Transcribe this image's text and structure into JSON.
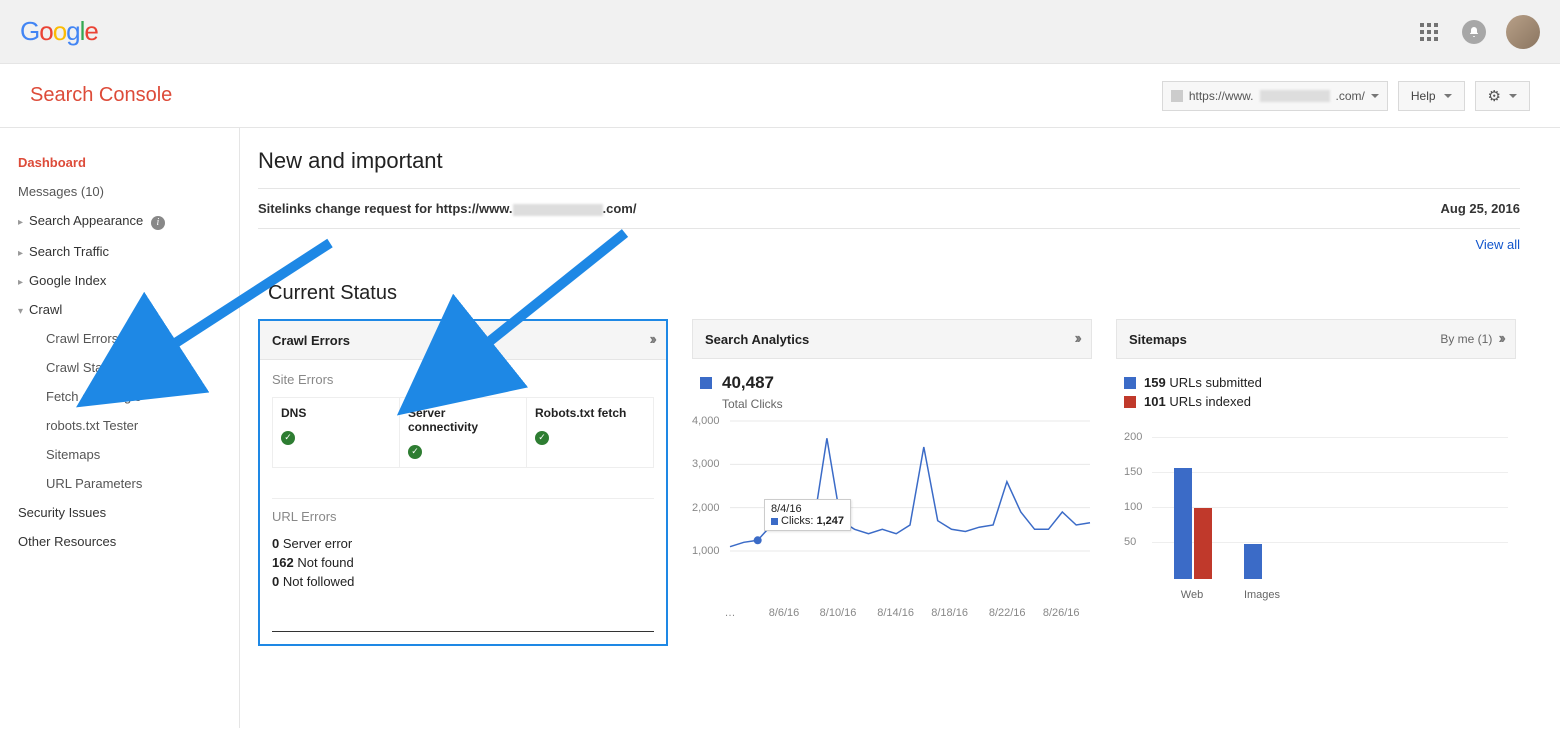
{
  "topbar": {
    "logo": "Google"
  },
  "header": {
    "app_title": "Search Console",
    "site_prefix": "https://www.",
    "site_suffix": ".com/",
    "help_label": "Help"
  },
  "sidebar": {
    "dashboard": "Dashboard",
    "messages": "Messages (10)",
    "search_appearance": "Search Appearance",
    "search_traffic": "Search Traffic",
    "google_index": "Google Index",
    "crawl": "Crawl",
    "crawl_errors": "Crawl Errors",
    "crawl_stats": "Crawl Stats",
    "fetch_as_google": "Fetch as Google",
    "robots_tester": "robots.txt Tester",
    "sitemaps": "Sitemaps",
    "url_parameters": "URL Parameters",
    "security_issues": "Security Issues",
    "other_resources": "Other Resources"
  },
  "content": {
    "new_important": "New and important",
    "message_prefix": "Sitelinks change request for https://www.",
    "message_suffix": ".com/",
    "message_date": "Aug 25, 2016",
    "view_all": "View all",
    "current_status": "Current Status"
  },
  "crawl_errors_card": {
    "title": "Crawl Errors",
    "site_errors": "Site Errors",
    "dns": "DNS",
    "server": "Server connectivity",
    "robots": "Robots.txt fetch",
    "url_errors": "URL Errors",
    "server_error_count": "0",
    "server_error_label": "Server error",
    "not_found_count": "162",
    "not_found_label": "Not found",
    "not_followed_count": "0",
    "not_followed_label": "Not followed"
  },
  "search_analytics_card": {
    "title": "Search Analytics",
    "total_clicks": "40,487",
    "total_clicks_label": "Total Clicks",
    "tooltip_date": "8/4/16",
    "tooltip_label": "Clicks:",
    "tooltip_value": "1,247"
  },
  "sitemaps_card": {
    "title": "Sitemaps",
    "by_me": "By me (1)",
    "submitted_count": "159",
    "submitted_label": "URLs submitted",
    "indexed_count": "101",
    "indexed_label": "URLs indexed",
    "cat_web": "Web",
    "cat_images": "Images"
  },
  "chart_data": [
    {
      "type": "line",
      "title": "Search Analytics — Total Clicks",
      "ylabel": "Clicks",
      "ylim": [
        1000,
        4000
      ],
      "yticks": [
        1000,
        2000,
        3000,
        4000
      ],
      "xticks": [
        "…",
        "8/6/16",
        "8/10/16",
        "8/14/16",
        "8/18/16",
        "8/22/16",
        "8/26/16"
      ],
      "series": [
        {
          "name": "Clicks",
          "color": "#3b6bc7",
          "x": [
            "8/2/16",
            "8/3/16",
            "8/4/16",
            "8/5/16",
            "8/6/16",
            "8/7/16",
            "8/8/16",
            "8/9/16",
            "8/10/16",
            "8/11/16",
            "8/12/16",
            "8/13/16",
            "8/14/16",
            "8/15/16",
            "8/16/16",
            "8/17/16",
            "8/18/16",
            "8/19/16",
            "8/20/16",
            "8/21/16",
            "8/22/16",
            "8/23/16",
            "8/24/16",
            "8/25/16",
            "8/26/16",
            "8/27/16",
            "8/28/16"
          ],
          "values": [
            1100,
            1200,
            1247,
            1600,
            1700,
            1500,
            1550,
            3600,
            1700,
            1500,
            1400,
            1500,
            1400,
            1600,
            3400,
            1700,
            1500,
            1450,
            1550,
            1600,
            2600,
            1900,
            1500,
            1500,
            1900,
            1600,
            1650
          ]
        }
      ],
      "tooltip": {
        "x": "8/4/16",
        "label": "Clicks",
        "value": 1247
      }
    },
    {
      "type": "bar",
      "title": "Sitemaps",
      "ylim": [
        0,
        200
      ],
      "yticks": [
        50,
        100,
        150,
        200
      ],
      "categories": [
        "Web",
        "Images"
      ],
      "series": [
        {
          "name": "URLs submitted",
          "color": "#3b6bc7",
          "values": [
            159,
            50
          ]
        },
        {
          "name": "URLs indexed",
          "color": "#c0392b",
          "values": [
            101,
            0
          ]
        }
      ]
    }
  ]
}
